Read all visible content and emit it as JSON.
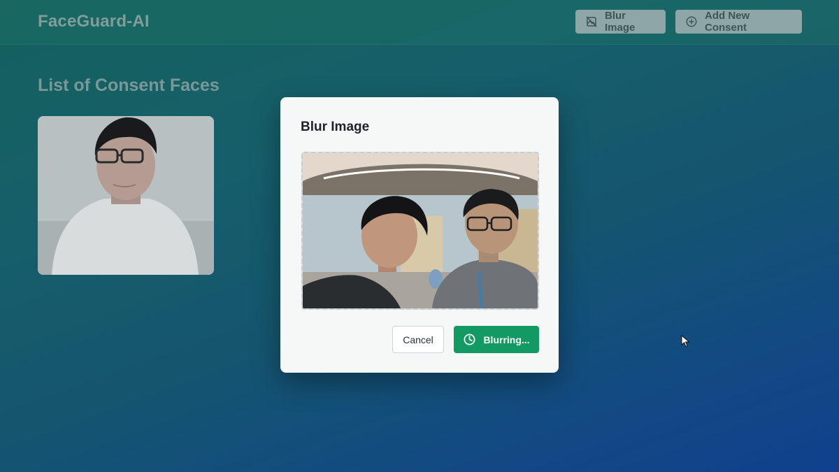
{
  "app": {
    "title": "FaceGuard-AI"
  },
  "header": {
    "blur_image_label": "Blur Image",
    "add_consent_label": "Add New Consent"
  },
  "main": {
    "section_title": "List of Consent Faces",
    "consent_faces": [
      {
        "icon": "person-photo"
      }
    ]
  },
  "dialog": {
    "title": "Blur Image",
    "cancel_label": "Cancel",
    "submit_label": "Blurring...",
    "submit_icon": "spinner-clock-icon"
  },
  "colors": {
    "primary_green": "#129a62",
    "overlay_bg": "#165f6a"
  }
}
